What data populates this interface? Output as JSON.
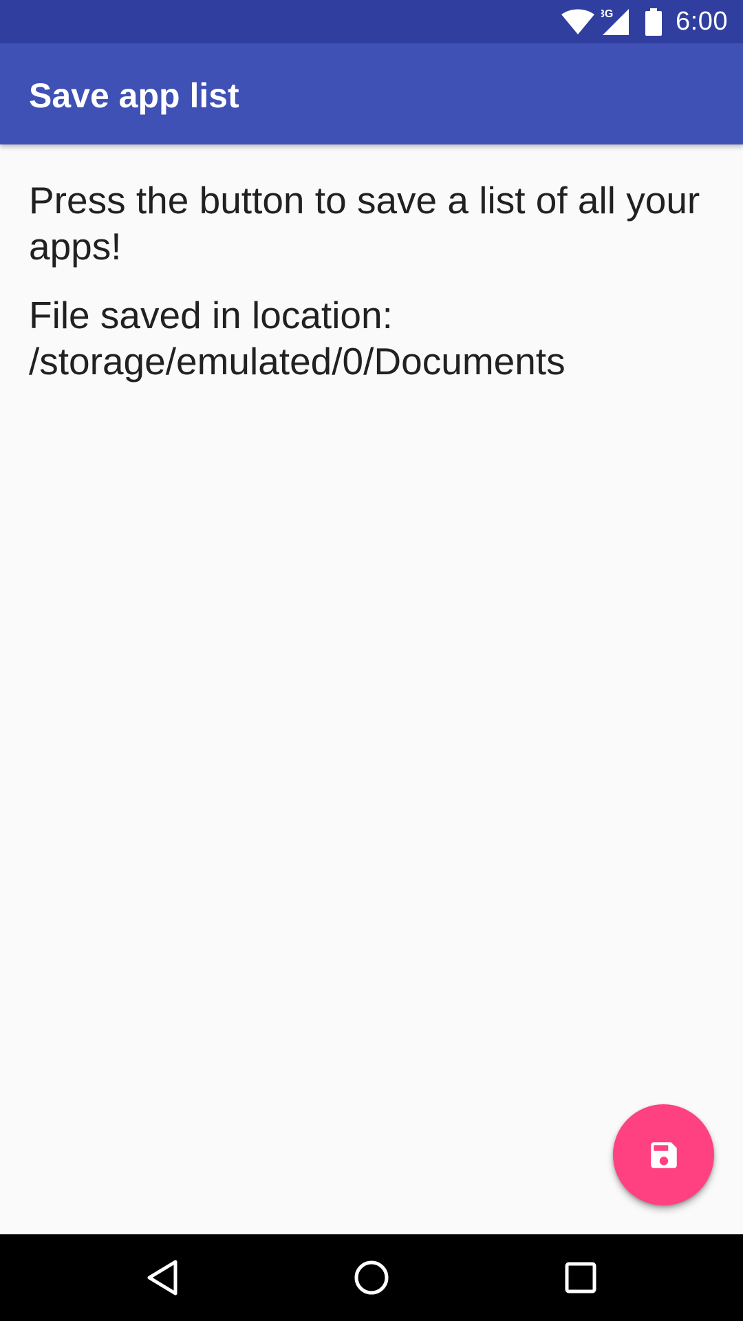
{
  "status_bar": {
    "network_label": "3G",
    "time": "6:00",
    "icons": [
      "wifi-icon",
      "signal-icon",
      "battery-icon"
    ]
  },
  "app_bar": {
    "title": "Save app list"
  },
  "main": {
    "instruction": "Press the button to save a list of all your apps!",
    "save_location": "File saved in location: /storage/emulated/0/Documents"
  },
  "fab": {
    "icon": "save-icon"
  },
  "nav_bar": {
    "buttons": [
      "back-icon",
      "home-icon",
      "recents-icon"
    ]
  },
  "colors": {
    "status_bar": "#303f9f",
    "app_bar": "#3f51b5",
    "fab": "#ff4081",
    "background": "#fafafa",
    "text": "#212121"
  }
}
